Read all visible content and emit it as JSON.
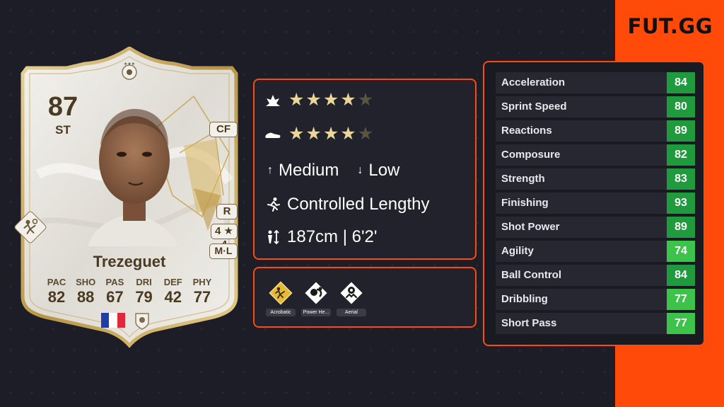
{
  "brand": {
    "logo_text": "FUT.GG",
    "accent_color": "#ff4a0a"
  },
  "card": {
    "rating": "87",
    "position": "ST",
    "alt_position": "CF",
    "preferred_foot": "R",
    "skill_weak": "4 ★ 4",
    "work_rates": "M·L",
    "name": "Trezeguet",
    "stats": [
      {
        "label": "PAC",
        "value": "82"
      },
      {
        "label": "SHO",
        "value": "88"
      },
      {
        "label": "PAS",
        "value": "67"
      },
      {
        "label": "DRI",
        "value": "79"
      },
      {
        "label": "DEF",
        "value": "42"
      },
      {
        "label": "PHY",
        "value": "77"
      }
    ],
    "nation_flag": "france",
    "club_badge": "icon-badge",
    "playstyle_plus": "acrobatic"
  },
  "info": {
    "skill_moves": {
      "icon": "skill-moves-icon",
      "stars": 4,
      "max": 5
    },
    "weak_foot": {
      "icon": "boot-icon",
      "stars": 4,
      "max": 5
    },
    "attack_work_rate": "Medium",
    "defense_work_rate": "Low",
    "accelerate_type": "Controlled Lengthy",
    "height": "187cm | 6'2'"
  },
  "playstyles": [
    {
      "label": "Acrobatic",
      "plus": true
    },
    {
      "label": "Power He...",
      "plus": false
    },
    {
      "label": "Aerial",
      "plus": false
    }
  ],
  "detail_stats": [
    {
      "name": "Acceleration",
      "value": "84",
      "color": "#1f9a3c"
    },
    {
      "name": "Sprint Speed",
      "value": "80",
      "color": "#1f9a3c"
    },
    {
      "name": "Reactions",
      "value": "89",
      "color": "#1f9a3c"
    },
    {
      "name": "Composure",
      "value": "82",
      "color": "#1f9a3c"
    },
    {
      "name": "Strength",
      "value": "83",
      "color": "#1f9a3c"
    },
    {
      "name": "Finishing",
      "value": "93",
      "color": "#1f9a3c"
    },
    {
      "name": "Shot Power",
      "value": "89",
      "color": "#1f9a3c"
    },
    {
      "name": "Agility",
      "value": "74",
      "color": "#3dc24a"
    },
    {
      "name": "Ball Control",
      "value": "84",
      "color": "#1f9a3c"
    },
    {
      "name": "Dribbling",
      "value": "77",
      "color": "#3dc24a"
    },
    {
      "name": "Short Pass",
      "value": "77",
      "color": "#3dc24a"
    }
  ]
}
